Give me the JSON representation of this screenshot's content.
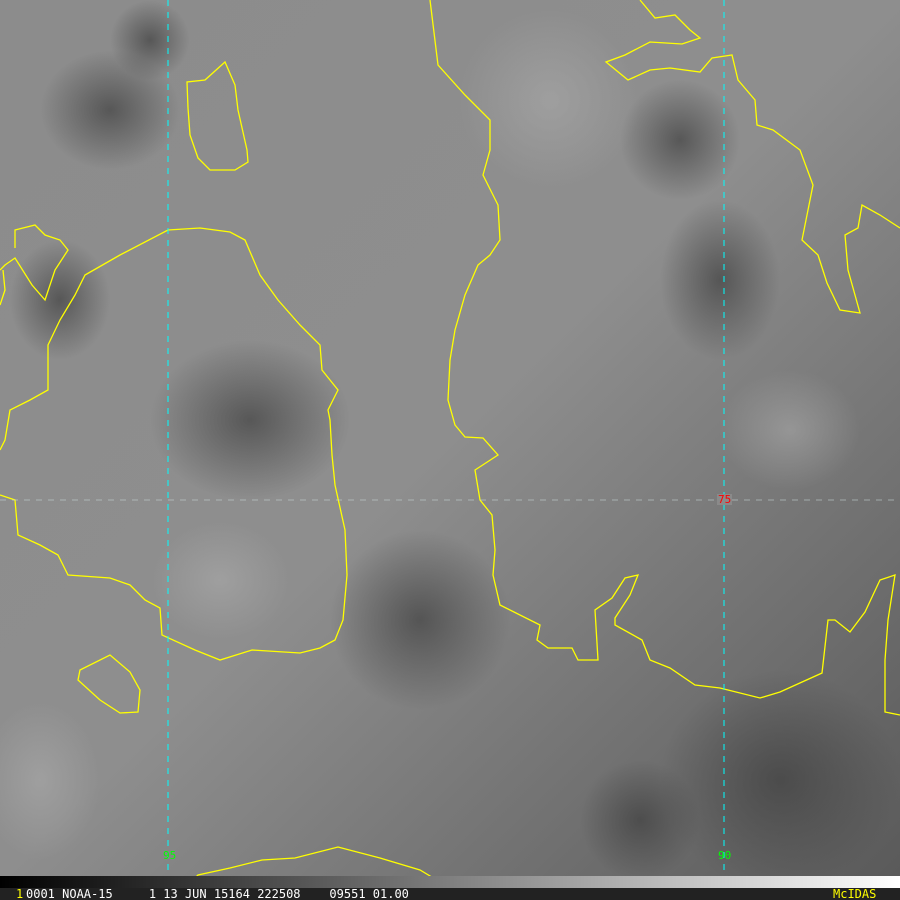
{
  "image": {
    "frame_number": "1",
    "status_line": "0001 NOAA-15     1 13 JUN 15164 222508    09551 01.00",
    "brand": "McIDAS"
  },
  "grid_labels": {
    "lat_75": "75",
    "lon_95": "95",
    "lon_90": "90"
  },
  "colors": {
    "coastline": "#ffff00",
    "graticule": "#00ffff",
    "lat_label": "#ff0000",
    "lon_label": "#00ff00",
    "frame_number": "#ffff00",
    "brand": "#ffff00"
  }
}
